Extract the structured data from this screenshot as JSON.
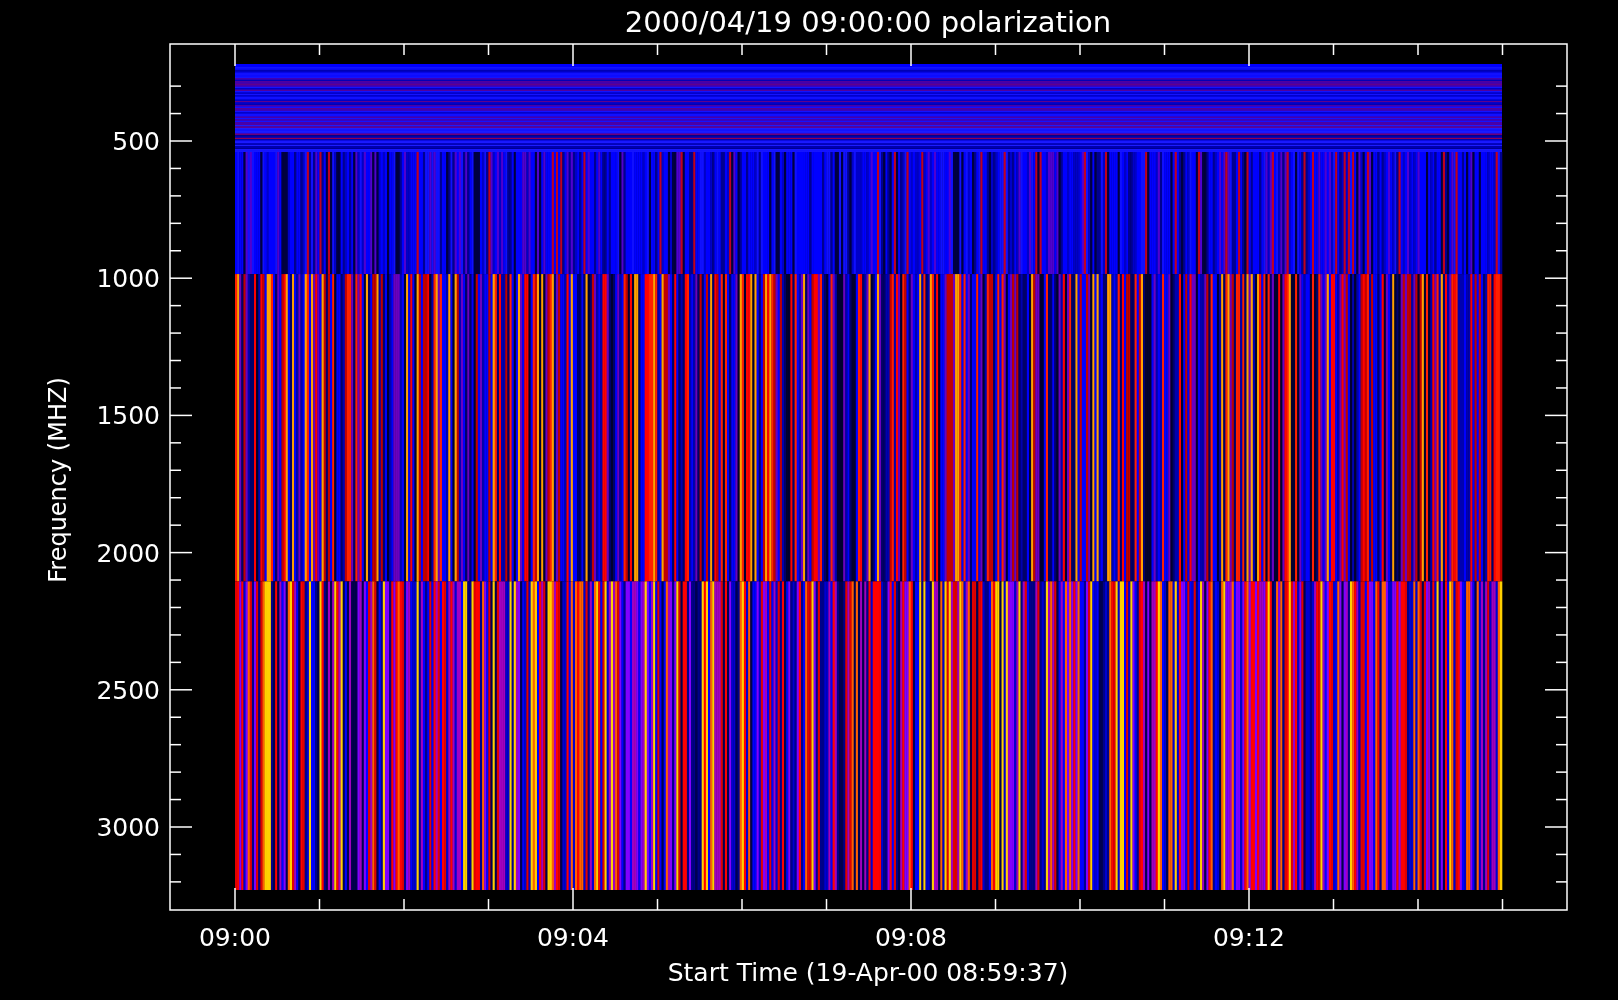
{
  "title": "2000/04/19 09:00:00 polarization",
  "y_axis": {
    "label": "Frequency (MHZ)",
    "ticks": [
      "500",
      "1000",
      "1500",
      "2000",
      "2500",
      "3000"
    ]
  },
  "x_axis": {
    "label": "Start Time (19-Apr-00 08:59:37)",
    "ticks": [
      "09:00",
      "09:04",
      "09:08",
      "09:12"
    ]
  }
}
